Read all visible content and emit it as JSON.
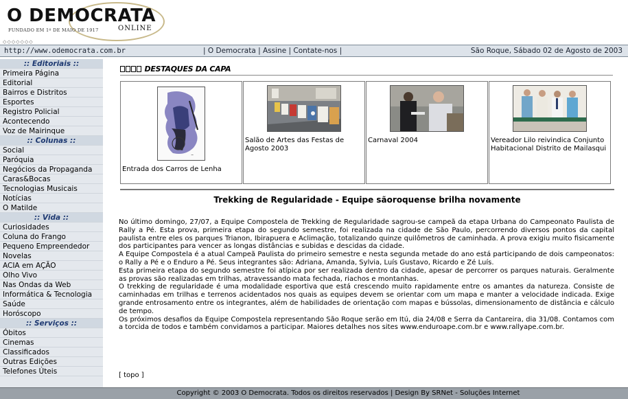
{
  "header": {
    "logo_main": "O DEMOCRATA",
    "logo_online": "ONLINE",
    "logo_founded": "FUNDADO EM 1º DE MAIO DE 1917",
    "diamonds": "◇◇◇◇◇◇◇"
  },
  "topbar": {
    "url": "http://www.odemocrata.com.br",
    "nav": [
      "O Democrata",
      "Assine",
      "Contate-nos"
    ],
    "date": "São Roque, Sábado 02 de Agosto de 2003"
  },
  "sidebar": {
    "sections": [
      {
        "title": ":: Editoriais ::",
        "items": [
          "Primeira Página",
          "Editorial",
          "Bairros e Distritos",
          "Esportes",
          "Registro Policial",
          "Acontecendo",
          "Voz de Mairinque"
        ]
      },
      {
        "title": ":: Colunas ::",
        "items": [
          "Social",
          "Paróquia",
          "Negócios da Propaganda",
          "Caras&Bocas",
          "Tecnologias Musicais",
          "Notícias",
          "O Matilde"
        ]
      },
      {
        "title": ":: Vida ::",
        "items": [
          "Curiosidades",
          "Coluna do Frango",
          "Pequeno Empreendedor",
          "Novelas",
          "ACIA em AÇÃO",
          "Olho Vivo",
          "Nas Ondas da Web",
          "Informática & Tecnologia",
          "Saúde",
          "Horóscopo"
        ]
      },
      {
        "title": ":: Serviços ::",
        "items": [
          "Óbitos",
          "Cinemas",
          "Classificados",
          "Outras Edições",
          "Telefones Úteis"
        ]
      }
    ]
  },
  "main": {
    "destaques_title": "DESTAQUES DA CAPA",
    "cards": [
      {
        "caption": "Entrada dos Carros de Lenha"
      },
      {
        "caption": "Salão de Artes das Festas de Agosto 2003"
      },
      {
        "caption": "Carnaval 2004"
      },
      {
        "caption": "Vereador Lilo reivindica Conjunto Habitacional Distrito de Mailasqui"
      }
    ],
    "article": {
      "title": "Trekking de Regularidade - Equipe sãoroquense brilha novamente",
      "paragraphs": [
        "No último domingo, 27/07, a Equipe Compostela de Trekking de Regularidade sagrou-se campeã da etapa Urbana do Campeonato Paulista de Rally a Pé. Esta prova, primeira etapa do segundo semestre, foi realizada na cidade de São Paulo, percorrendo diversos pontos da capital paulista entre eles os parques Trianon, Ibirapuera e Aclimação, totalizando quinze quilômetros de caminhada. A prova exigiu muito fisicamente dos participantes para vencer as longas distâncias e subidas e descidas da cidade.",
        "A Equipe Compostela é a atual Campeã Paulista do primeiro semestre e nesta segunda metade do ano está participando de dois campeonatos: o Rally a Pé e o Enduro a Pé. Seus integrantes são: Adriana, Amanda, Sylvia, Luís Gustavo, Ricardo e Zé Luís.",
        "Esta primeira etapa do segundo semestre foi atípica por ser realizada dentro da cidade, apesar de percorrer os parques naturais. Geralmente as provas são realizadas em trilhas, atravessando mata fechada, riachos e montanhas.",
        "O trekking de regularidade é uma modalidade esportiva que está crescendo muito rapidamente entre os amantes da natureza. Consiste de caminhadas em trilhas e terrenos acidentados nos quais as equipes devem se orientar com um mapa e manter a velocidade indicada. Exige grande entrosamento entre os integrantes, além de habilidades de orientação com mapas e bússolas, dimensionamento de distância e cálculo de tempo.",
        "Os próximos desafios da Equipe Compostela representando São Roque serão em Itú, dia 24/08 e Serra da Cantareira, dia 31/08. Contamos com a torcida de todos e também convidamos a participar. Maiores detalhes nos sites www.enduroape.com.br e www.rallyape.com.br."
      ]
    },
    "top_link": "[ topo ]"
  },
  "footer": {
    "text": "Copyright © 2003 O Democrata. Todos os direitos reservados | Design By SRNet - Soluções Internet"
  }
}
